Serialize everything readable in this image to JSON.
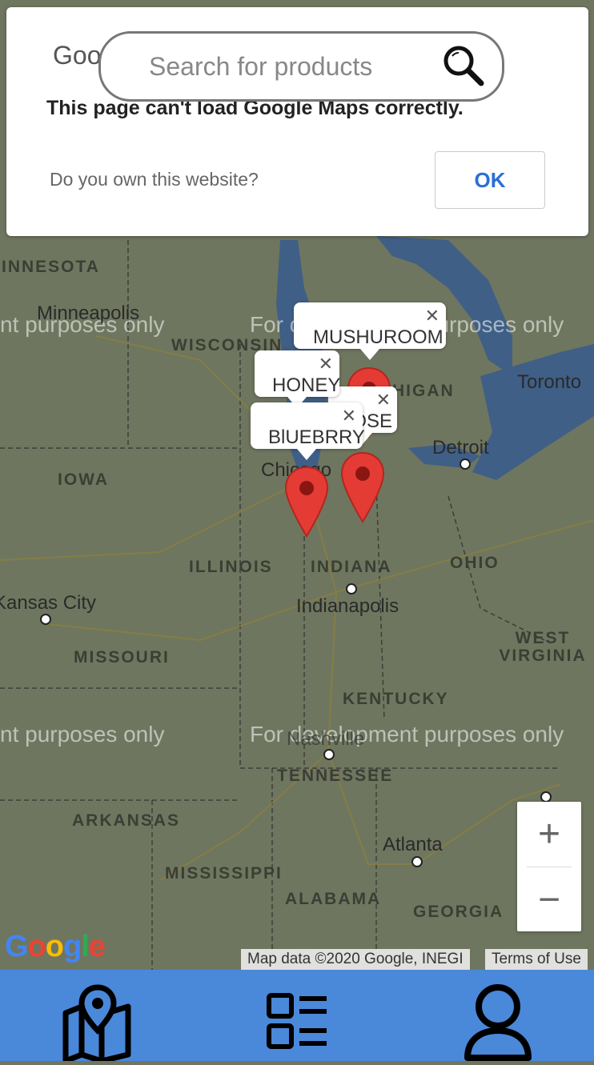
{
  "dialog": {
    "google_text": "Goo",
    "error_text": "This page can't load Google Maps correctly.",
    "own_text": "Do you own this website?",
    "ok_label": "OK"
  },
  "search": {
    "placeholder": "Search for products",
    "icon": "search-icon"
  },
  "map": {
    "watermark": "For development purposes only",
    "watermark_left": "nt purposes only",
    "states": [
      "INNESOTA",
      "WISCONSIN",
      "IOWA",
      "ILLINOIS",
      "INDIANA",
      "OHIO",
      "MISSOURI",
      "KENTUCKY",
      "WEST VIRGINIA",
      "TENNESSEE",
      "ARKANSAS",
      "MISSISSIPPI",
      "ALABAMA",
      "GEORGIA",
      "HIGAN"
    ],
    "cities": [
      "Minneapolis",
      "Toronto",
      "Detroit",
      "Chicago",
      "Indianapolis",
      "Kansas City",
      "Nashville",
      "Atlanta"
    ],
    "markers": [
      "MUSHUROOM",
      "HONEY",
      "ROSE",
      "BlUEBRRY"
    ],
    "close_glyph": "✕",
    "zoom_in": "+",
    "zoom_out": "−",
    "attribution": "Map data ©2020 Google, INEGI",
    "terms": "Terms of Use",
    "logo": "Google"
  },
  "nav": {
    "items": [
      "map-icon",
      "list-icon",
      "user-icon"
    ],
    "bg_color": "#4a88da"
  }
}
